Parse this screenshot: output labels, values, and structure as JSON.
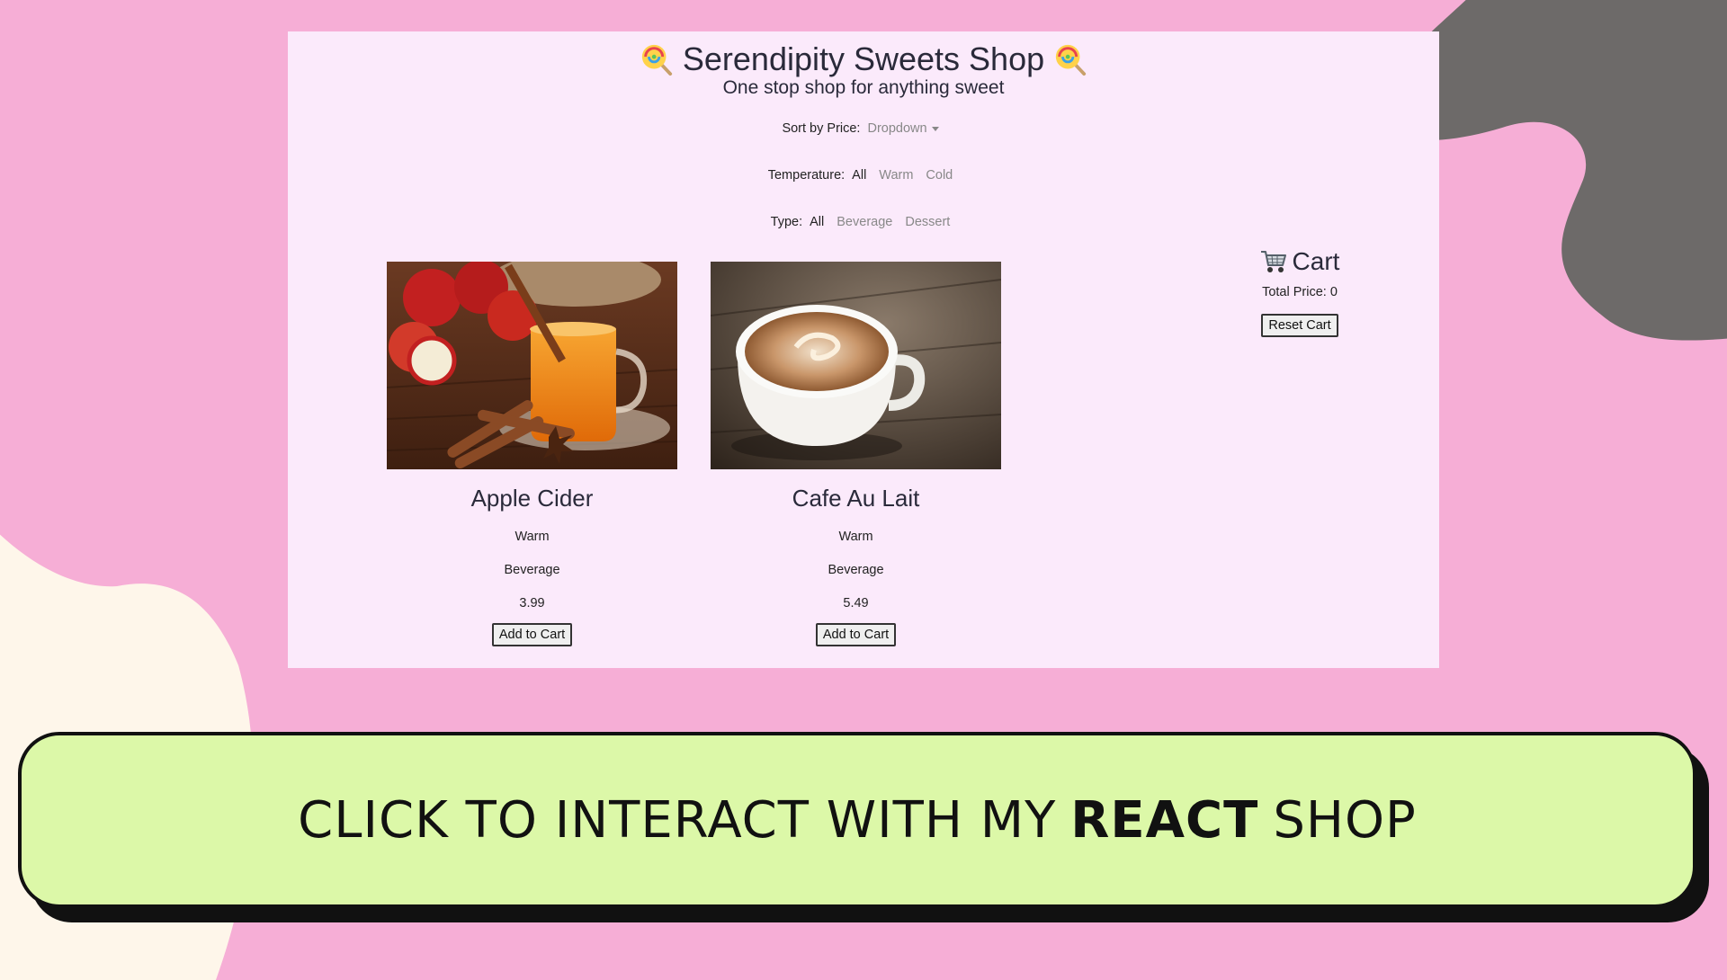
{
  "colors": {
    "background": "#f6aed6",
    "panel": "#fbeafb",
    "blob_dark": "#6d6a69",
    "blob_cream": "#fef6ea",
    "cta_background": "#dcf8a8",
    "cta_border": "#111111"
  },
  "shop": {
    "title": "Serendipity Sweets Shop",
    "subtitle": "One stop shop for anything sweet",
    "sort": {
      "label": "Sort by Price:",
      "dropdown": "Dropdown"
    },
    "temperature": {
      "label": "Temperature:",
      "options": [
        "All",
        "Warm",
        "Cold"
      ],
      "selected": "All"
    },
    "type": {
      "label": "Type:",
      "options": [
        "All",
        "Beverage",
        "Dessert"
      ],
      "selected": "All"
    }
  },
  "products": [
    {
      "name": "Apple Cider",
      "temperature": "Warm",
      "type": "Beverage",
      "price": "3.99",
      "button": "Add to Cart",
      "image": "apple-cider-photo"
    },
    {
      "name": "Cafe Au Lait",
      "temperature": "Warm",
      "type": "Beverage",
      "price": "5.49",
      "button": "Add to Cart",
      "image": "cafe-au-lait-photo"
    }
  ],
  "cart": {
    "title": "Cart",
    "total_label": "Total Price: 0",
    "reset_label": "Reset Cart"
  },
  "cta": {
    "prefix": "CLICK TO INTERACT WITH MY",
    "bold": "REACT",
    "suffix": "SHOP"
  }
}
